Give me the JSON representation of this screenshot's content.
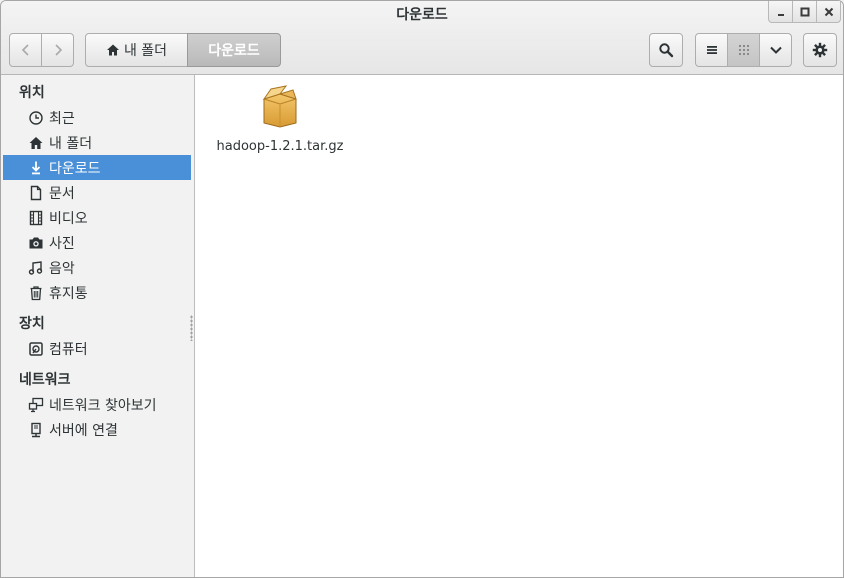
{
  "window": {
    "title": "다운로드"
  },
  "toolbar": {
    "breadcrumbs": [
      {
        "label": "내 폴더",
        "icon": "home-icon"
      },
      {
        "label": "다운로드"
      }
    ]
  },
  "sidebar": {
    "sections": [
      {
        "heading": "위치",
        "items": [
          {
            "label": "최근",
            "icon": "clock-icon"
          },
          {
            "label": "내 폴더",
            "icon": "home-icon"
          },
          {
            "label": "다운로드",
            "icon": "download-icon",
            "active": true
          },
          {
            "label": "문서",
            "icon": "document-icon"
          },
          {
            "label": "비디오",
            "icon": "film-icon"
          },
          {
            "label": "사진",
            "icon": "camera-icon"
          },
          {
            "label": "음악",
            "icon": "music-icon"
          },
          {
            "label": "휴지통",
            "icon": "trash-icon"
          }
        ]
      },
      {
        "heading": "장치",
        "items": [
          {
            "label": "컴퓨터",
            "icon": "drive-icon"
          }
        ]
      },
      {
        "heading": "네트워크",
        "items": [
          {
            "label": "네트워크 찾아보기",
            "icon": "network-icon"
          },
          {
            "label": "서버에 연결",
            "icon": "server-icon"
          }
        ]
      }
    ]
  },
  "content": {
    "files": [
      {
        "name": "hadoop-1.2.1.tar.gz",
        "icon": "package-icon"
      }
    ]
  },
  "colors": {
    "accent": "#4a90d9"
  }
}
